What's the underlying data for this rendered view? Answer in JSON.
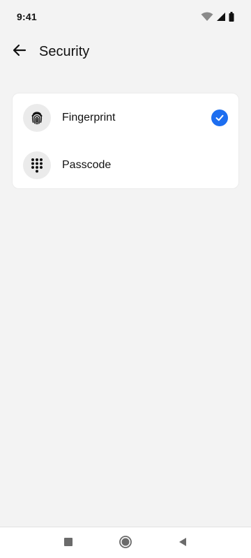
{
  "status_bar": {
    "time": "9:41",
    "icons": [
      "wifi-icon",
      "cellular-signal-icon",
      "battery-icon"
    ]
  },
  "header": {
    "back_icon": "arrow-left-icon",
    "title": "Security"
  },
  "options": [
    {
      "icon": "fingerprint-icon",
      "label": "Fingerprint",
      "selected": true
    },
    {
      "icon": "keypad-icon",
      "label": "Passcode",
      "selected": false
    }
  ],
  "nav_bar": {
    "items": [
      "recents-square-icon",
      "home-circle-icon",
      "back-triangle-icon"
    ]
  },
  "colors": {
    "background": "#f3f3f3",
    "card": "#ffffff",
    "accent": "#1d6ef0",
    "icon_bg": "#ebebeb"
  }
}
